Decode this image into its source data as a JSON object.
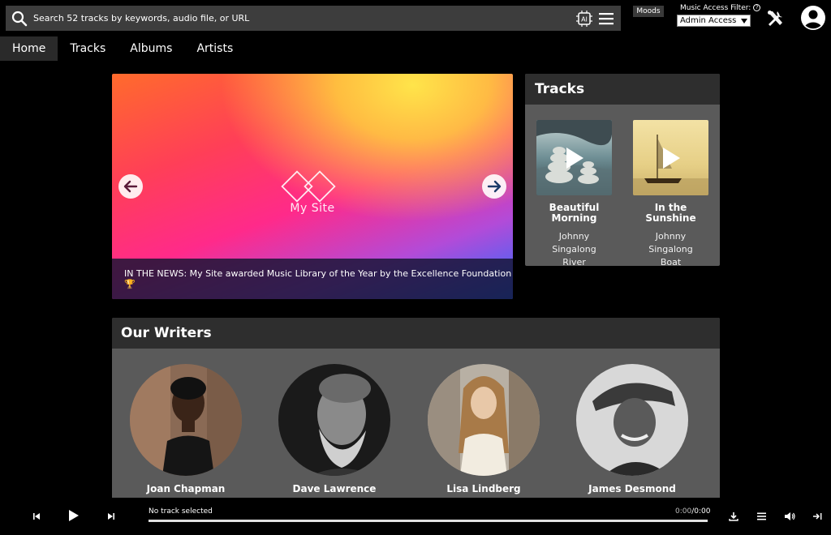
{
  "search": {
    "placeholder": "Search 52 tracks by keywords, audio file, or URL",
    "value": ""
  },
  "header": {
    "moods_label": "Moods",
    "access_filter_label": "Music Access Filter:",
    "access_filter_value": "Admin Access"
  },
  "nav": {
    "tabs": [
      {
        "label": "Home",
        "active": true
      },
      {
        "label": "Tracks",
        "active": false
      },
      {
        "label": "Albums",
        "active": false
      },
      {
        "label": "Artists",
        "active": false
      }
    ]
  },
  "hero": {
    "site_name": "My Site",
    "news": "IN THE NEWS: My Site awarded Music Library of the Year by the Excellence Foundation 🏆"
  },
  "tracks_panel": {
    "title": "Tracks",
    "items": [
      {
        "title": "Beautiful Morning",
        "artist": "Johnny Singalong",
        "subtitle": "River"
      },
      {
        "title": "In the Sunshine",
        "artist": "Johnny Singalong",
        "subtitle": "Boat"
      }
    ]
  },
  "writers": {
    "title": "Our Writers",
    "items": [
      {
        "name": "Joan Chapman"
      },
      {
        "name": "Dave Lawrence"
      },
      {
        "name": "Lisa Lindberg"
      },
      {
        "name": "James Desmond"
      }
    ]
  },
  "player": {
    "now_playing": "No track selected",
    "time_current": "0:00",
    "time_total": "0:00",
    "progress": 0
  },
  "colors": {
    "topbar": "#3d3d3d",
    "panel": "#5a5a5a",
    "panel_header": "#2e2e2e",
    "background": "#000000"
  },
  "icons": [
    "search-icon",
    "ai-icon",
    "menu-icon",
    "help-icon",
    "tools-icon",
    "avatar-icon",
    "arrow-left-icon",
    "arrow-right-icon",
    "play-icon",
    "skip-back-icon",
    "skip-forward-icon",
    "download-icon",
    "queue-icon",
    "volume-icon",
    "exit-icon"
  ]
}
